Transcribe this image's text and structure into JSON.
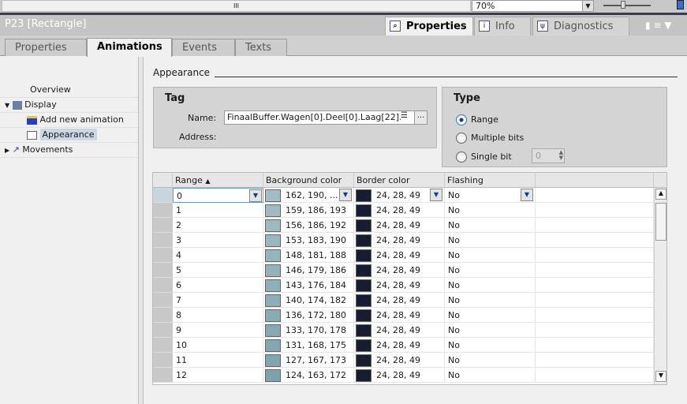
{
  "top": {
    "zoom": "70%",
    "hscroll_grip": "III"
  },
  "header": {
    "title": "P23 [Rectangle]",
    "tabs": [
      {
        "label": "Properties",
        "icon": "magnifier-icon",
        "active": true
      },
      {
        "label": "Info",
        "icon": "info-icon",
        "active": false
      },
      {
        "label": "Diagnostics",
        "icon": "diagnostics-icon",
        "active": false
      }
    ]
  },
  "subtabs": [
    {
      "label": "Properties"
    },
    {
      "label": "Animations"
    },
    {
      "label": "Events"
    },
    {
      "label": "Texts"
    }
  ],
  "nav": {
    "overview": "Overview",
    "display": "Display",
    "add_new": "Add new animation",
    "appearance": "Appearance",
    "movements": "Movements"
  },
  "section_title": "Appearance",
  "tag": {
    "title": "Tag",
    "name_label": "Name:",
    "name_value": "FinaalBuffer.Wagen[0].Deel[0].Laag[22].l",
    "address_label": "Address:",
    "browse": "..."
  },
  "type": {
    "title": "Type",
    "range": "Range",
    "multiple_bits": "Multiple bits",
    "single_bit": "Single bit",
    "single_bit_value": "0",
    "selected": "range"
  },
  "table": {
    "headers": {
      "range": "Range",
      "background": "Background color",
      "border": "Border color",
      "flashing": "Flashing"
    },
    "rows": [
      {
        "range": "0",
        "bg": "162, 190, ...",
        "bg_hex": "#a2bec5",
        "border": "24, 28, 49",
        "flashing": "No"
      },
      {
        "range": "1",
        "bg": "159, 186, 193",
        "border": "24, 28, 49",
        "flashing": "No"
      },
      {
        "range": "2",
        "bg": "156, 186, 192",
        "border": "24, 28, 49",
        "flashing": "No"
      },
      {
        "range": "3",
        "bg": "153, 183, 190",
        "border": "24, 28, 49",
        "flashing": "No"
      },
      {
        "range": "4",
        "bg": "148, 181, 188",
        "border": "24, 28, 49",
        "flashing": "No"
      },
      {
        "range": "5",
        "bg": "146, 179, 186",
        "border": "24, 28, 49",
        "flashing": "No"
      },
      {
        "range": "6",
        "bg": "143, 176, 184",
        "border": "24, 28, 49",
        "flashing": "No"
      },
      {
        "range": "7",
        "bg": "140, 174, 182",
        "border": "24, 28, 49",
        "flashing": "No"
      },
      {
        "range": "8",
        "bg": "136, 172, 180",
        "border": "24, 28, 49",
        "flashing": "No"
      },
      {
        "range": "9",
        "bg": "133, 170, 178",
        "border": "24, 28, 49",
        "flashing": "No"
      },
      {
        "range": "10",
        "bg": "131, 168, 175",
        "border": "24, 28, 49",
        "flashing": "No"
      },
      {
        "range": "11",
        "bg": "127, 167, 173",
        "border": "24, 28, 49",
        "flashing": "No"
      },
      {
        "range": "12",
        "bg": "124, 163, 172",
        "border": "24, 28, 49",
        "flashing": "No"
      }
    ]
  }
}
